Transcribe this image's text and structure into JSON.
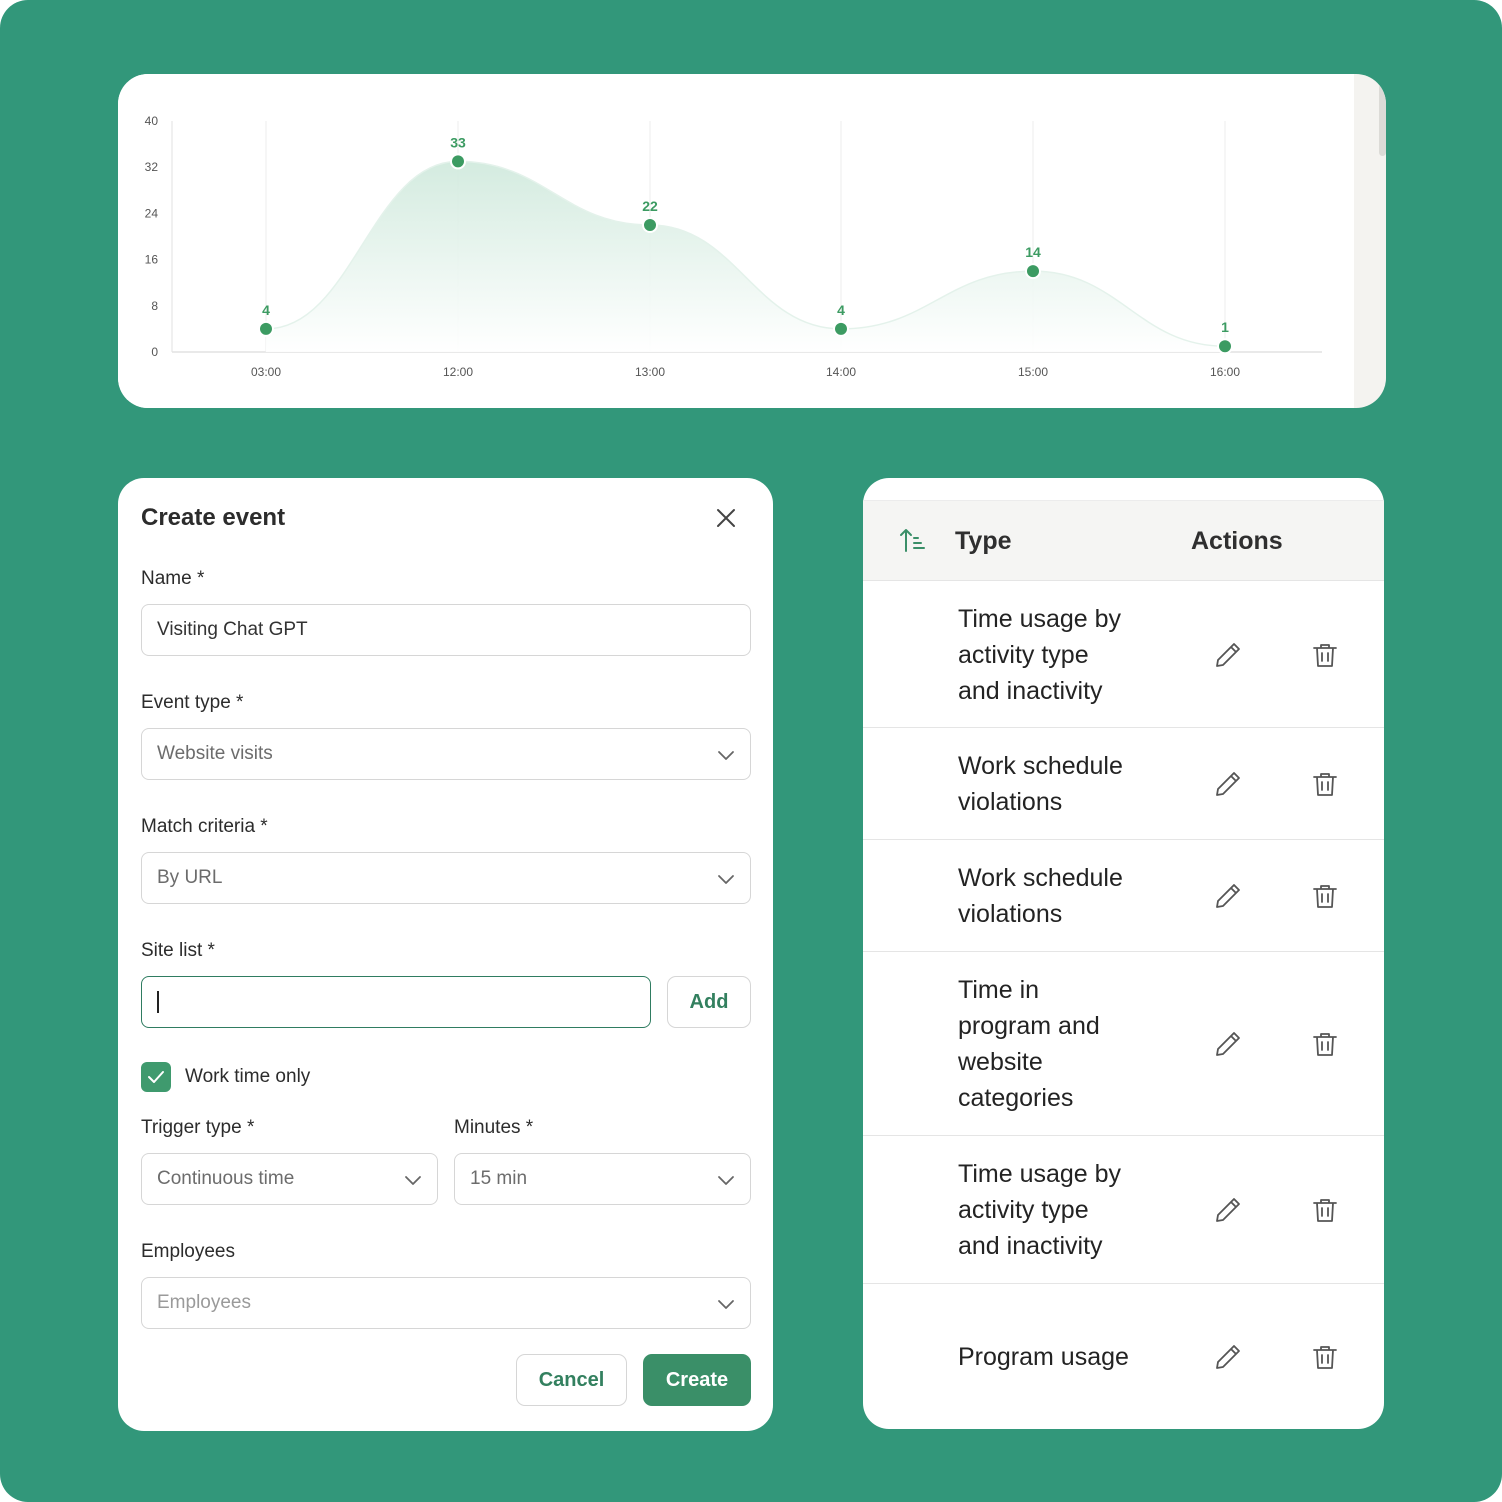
{
  "colors": {
    "background": "#32977a",
    "accent": "#3a8f68",
    "chart_point": "#3c9b62"
  },
  "chart_data": {
    "type": "area",
    "x": [
      "03:00",
      "12:00",
      "13:00",
      "14:00",
      "15:00",
      "16:00"
    ],
    "values": [
      4,
      33,
      22,
      4,
      14,
      1
    ],
    "ylim": [
      0,
      40
    ],
    "yticks": [
      "0",
      "8",
      "16",
      "24",
      "32",
      "40"
    ],
    "data_labels": [
      "4",
      "33",
      "22",
      "4",
      "14",
      "1"
    ],
    "grid": "vertical",
    "title": "",
    "xlabel": "",
    "ylabel": ""
  },
  "dialog": {
    "title": "Create event",
    "name_label": "Name *",
    "name_value": "Visiting Chat GPT",
    "event_type_label": "Event type *",
    "event_type_value": "Website visits",
    "match_label": "Match criteria *",
    "match_value": "By URL",
    "site_list_label": "Site list *",
    "site_list_value": "",
    "add_label": "Add",
    "work_time_label": "Work time only",
    "work_time_checked": true,
    "trigger_label": "Trigger type *",
    "trigger_value": "Continuous time",
    "minutes_label": "Minutes *",
    "minutes_value": "15 min",
    "employees_label": "Employees",
    "employees_placeholder": "Employees",
    "cancel_label": "Cancel",
    "create_label": "Create",
    "icons": {
      "close": "close-icon",
      "dropdown": "chevron-down-icon",
      "check": "check-icon"
    }
  },
  "table": {
    "headers": {
      "type": "Type",
      "actions": "Actions"
    },
    "icons": {
      "sort": "sort-ascending-icon",
      "edit": "pencil-icon",
      "delete": "trash-icon"
    },
    "rows": [
      {
        "lines": [
          "Time usage by",
          "activity type",
          "and inactivity"
        ]
      },
      {
        "lines": [
          "Work schedule",
          "violations"
        ]
      },
      {
        "lines": [
          "Work schedule",
          "violations"
        ]
      },
      {
        "lines": [
          "Time in",
          "program and",
          "website",
          "categories"
        ]
      },
      {
        "lines": [
          "Time usage by",
          "activity type",
          "and inactivity"
        ]
      },
      {
        "lines": [
          "Program usage"
        ]
      }
    ]
  }
}
